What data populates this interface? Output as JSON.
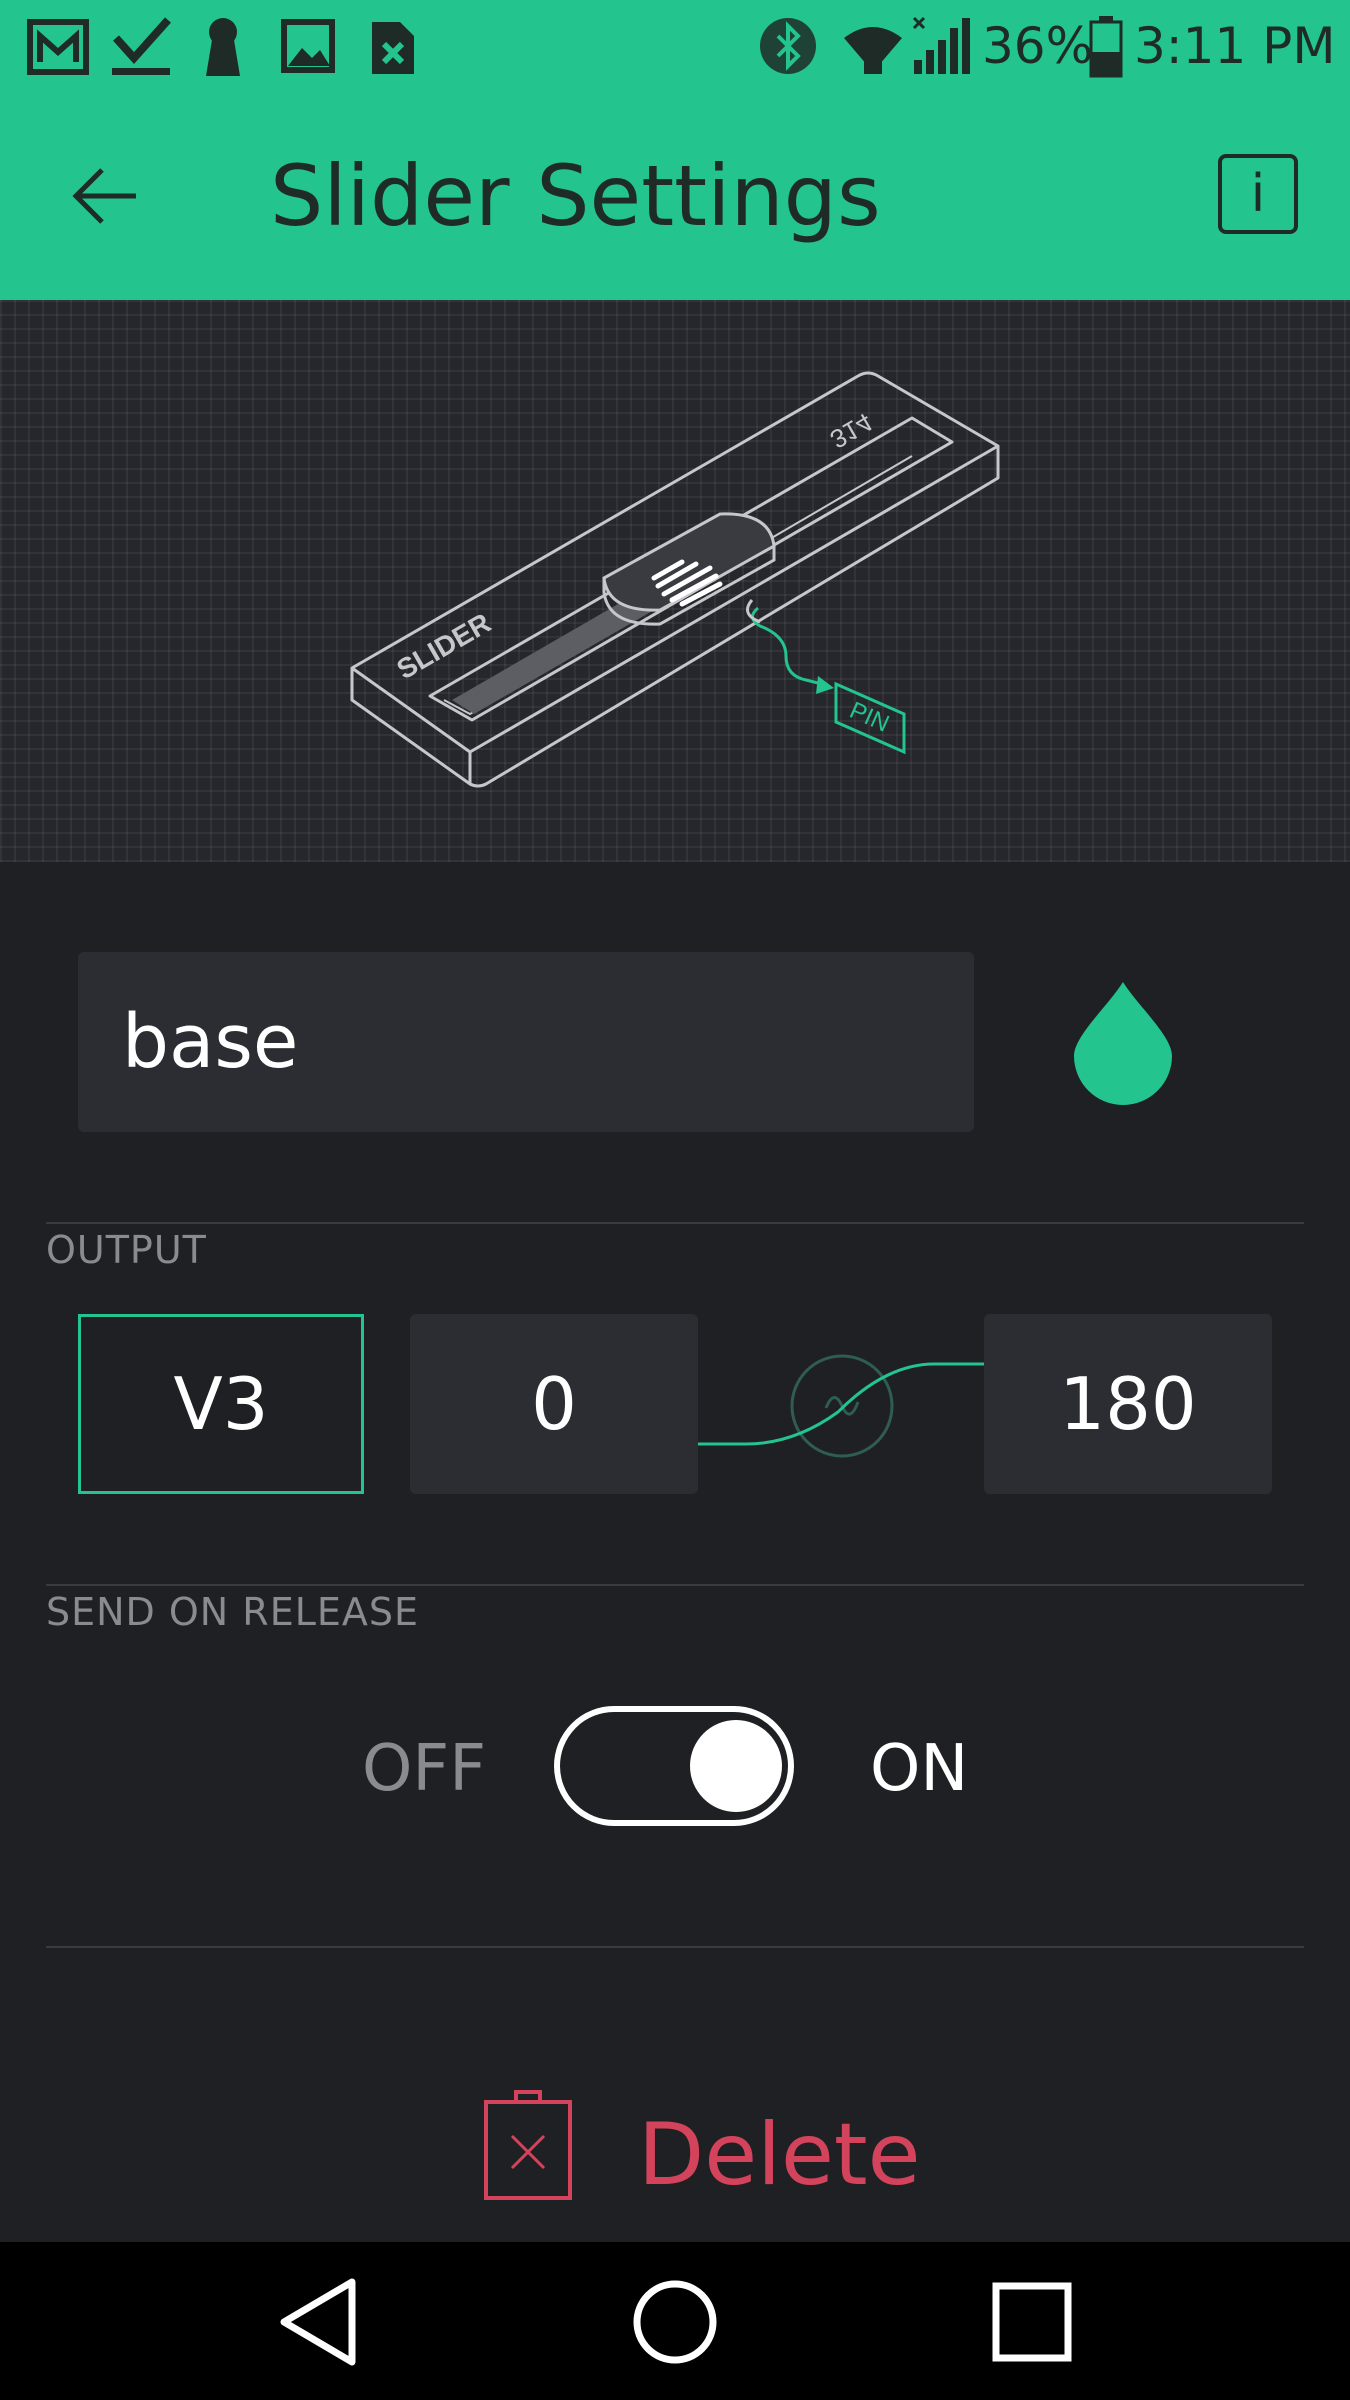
{
  "status_bar": {
    "battery": "36%",
    "time": "3:11 PM",
    "icons": [
      "gmail-icon",
      "download-done-icon",
      "keyhole-icon",
      "image-icon",
      "sim-error-icon",
      "bluetooth-icon",
      "wifi-icon",
      "signal-icon",
      "battery-icon"
    ]
  },
  "header": {
    "title": "Slider Settings",
    "info_label": "i"
  },
  "illustration": {
    "brand_label": "SLIDER",
    "value_label": "314",
    "pin_label": "PIN"
  },
  "name_field": {
    "value": "base"
  },
  "accent_color": "#23c48e",
  "output": {
    "section_label": "OUTPUT",
    "pin": "V3",
    "min": "0",
    "max": "180"
  },
  "send_on_release": {
    "section_label": "SEND ON RELEASE",
    "off_label": "OFF",
    "on_label": "ON",
    "state": "on"
  },
  "delete_label": "Delete",
  "colors": {
    "delete": "#d3435c",
    "background": "#1f2024",
    "field": "#2c2d32"
  }
}
